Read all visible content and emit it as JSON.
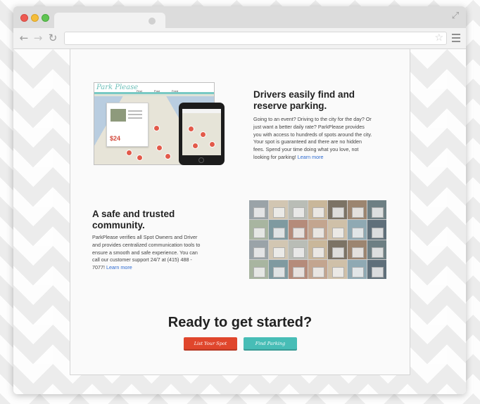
{
  "browser": {
    "tab_title": "",
    "address": "",
    "nav": {
      "back_icon": "←",
      "forward_icon": "→",
      "reload_icon": "↻"
    },
    "star_icon": "☆",
    "expand_icon": "⤢"
  },
  "app_mock": {
    "logo": "Park Please",
    "tabs": [
      "Find",
      "Post",
      "Feed"
    ],
    "price": "$24"
  },
  "feature_find": {
    "heading": "Drivers easily find and reserve parking.",
    "body": "Going to an event? Driving to the city for the day? Or just want a better daily rate? ParkPlease provides you with access to hundreds of spots around the city. Your spot is guaranteed and there are no hidden fees. Spend your time doing what you love, not looking for parking! ",
    "link": "Learn more"
  },
  "feature_community": {
    "heading": "A safe and trusted community.",
    "body": "ParkPlease verifies all Spot Owners and Driver and provides centralized communication tools to ensure a smooth and safe experience. You can call our customer support 24/7 at (415) 488 - 7077! ",
    "link": "Learn more"
  },
  "cta": {
    "title": "Ready to get started?",
    "list_button": "List Your Spot",
    "find_button": "Find Parking"
  },
  "colors": {
    "accent_red": "#e0462c",
    "accent_teal": "#47bdb6",
    "link_blue": "#2d6bd1"
  }
}
